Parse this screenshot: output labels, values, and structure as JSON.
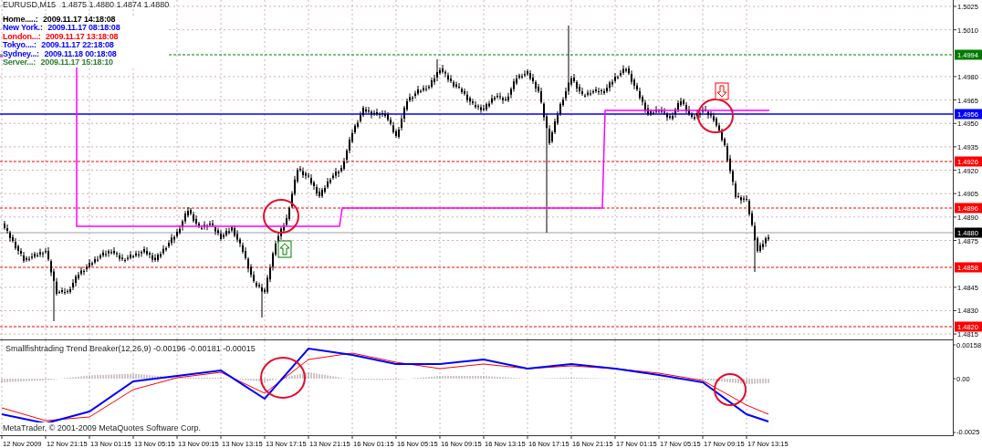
{
  "symbol": {
    "title": "EURUSD,M15",
    "ohlc": "1.4875 1.4880 1.4874 1.4880"
  },
  "clocks": [
    {
      "label": "Home.....:",
      "time": "2009.11.17 14:18:08",
      "color": "#000000"
    },
    {
      "label": "New York.:",
      "time": "2009.11.17 08:18:08",
      "color": "#0000ff"
    },
    {
      "label": "London...:",
      "time": "2009.11.17 13:18:08",
      "color": "#ff0000"
    },
    {
      "label": "Tokyo....:",
      "time": "2009.11.17 22:18:08",
      "color": "#0000ff"
    },
    {
      "label": "Sydney...:",
      "time": "2009.11.18 00:18:08",
      "color": "#0000ff"
    },
    {
      "label": "Server...:",
      "time": "2009.11.17 15:18:10",
      "color": "#2e7d32"
    }
  ],
  "price_axis": {
    "labels": [
      "1.5025",
      "1.5010",
      "1.4980",
      "1.4965",
      "1.4950",
      "1.4935",
      "1.4920",
      "1.4905",
      "1.4890",
      "1.4875",
      "1.4845",
      "1.4830",
      "1.4815"
    ],
    "tags": [
      {
        "label": "1.4994",
        "color": "#007a00"
      },
      {
        "label": "1.4956",
        "color": "#0000ff"
      },
      {
        "label": "1.4926",
        "color": "#ff0000"
      },
      {
        "label": "1.4896",
        "color": "#ff0000"
      },
      {
        "label": "1.4880",
        "color": "#000000"
      },
      {
        "label": "1.4858",
        "color": "#ff0000"
      },
      {
        "label": "1.4820",
        "color": "#ff0000"
      }
    ]
  },
  "indicator": {
    "label": "Smallfishtrading Trend Breaker(12,26,9) -0.00196 -0.00181 -0.00015",
    "axis_labels": [
      "0.00158",
      "0.00",
      "-0.0025"
    ]
  },
  "time_axis": [
    "12 Nov 2009",
    "12 Nov 21:15",
    "13 Nov 01:15",
    "13 Nov 05:15",
    "13 Nov 09:15",
    "13 Nov 13:15",
    "13 Nov 17:15",
    "13 Nov 21:15",
    "16 Nov 01:15",
    "16 Nov 05:15",
    "16 Nov 09:15",
    "16 Nov 13:15",
    "16 Nov 17:15",
    "16 Nov 21:15",
    "17 Nov 01:15",
    "17 Nov 05:15",
    "17 Nov 09:15",
    "17 Nov 13:15"
  ],
  "copyright": "MetaTrader, © 2001-2009 MetaQuotes Software Corp."
}
